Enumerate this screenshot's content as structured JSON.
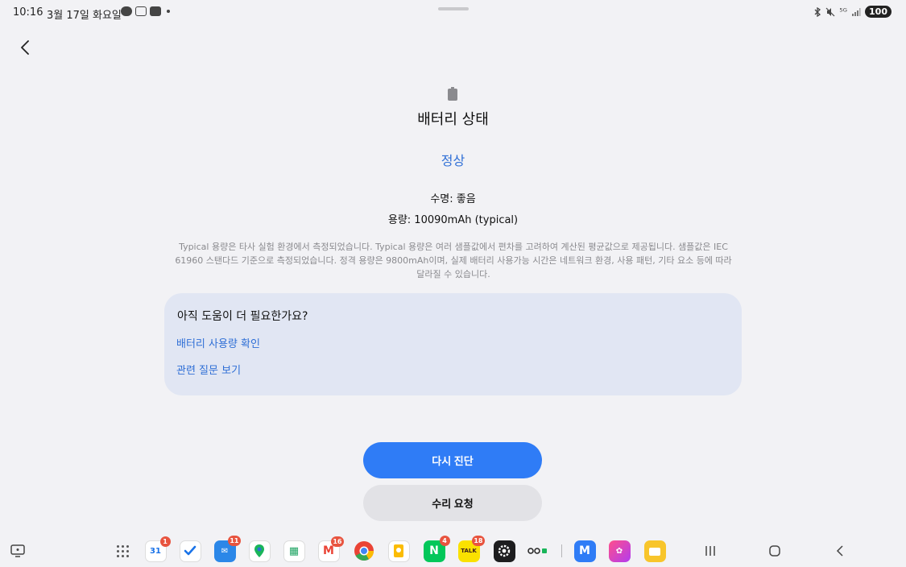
{
  "status_bar": {
    "time": "10:16",
    "date": "3월 17일 화요일",
    "battery_level": "100",
    "icons_left": [
      "talk-icon",
      "screenshot-icon",
      "youtube-icon",
      "dot-icon"
    ],
    "icons_right": [
      "bluetooth-icon",
      "mute-icon",
      "5g-icon",
      "signal-icon"
    ]
  },
  "header": {
    "back_icon": "back-arrow-icon"
  },
  "battery": {
    "title": "배터리 상태",
    "status": "정상",
    "lifespan": "수명: 좋음",
    "capacity": "용량: 10090mAh (typical)",
    "note": "Typical 용량은 타사 실험 환경에서 측정되었습니다. Typical 용량은 여러 샘플값에서 편차를 고려하여 계산된 평균값으로 제공됩니다. 샘플값은 IEC 61960 스탠다드 기준으로 측정되었습니다. 정격 용량은 9800mAh이며, 실제 배터리 사용가능 시간은 네트워크 환경, 사용 패턴, 기타 요소 등에 따라 달라질 수 있습니다."
  },
  "help": {
    "title": "아직 도움이 더 필요한가요?",
    "link_usage": "배터리 사용량 확인",
    "link_faq": "관련 질문 보기"
  },
  "buttons": {
    "rediagnose": "다시 진단",
    "repair_request": "수리 요청"
  },
  "taskbar": {
    "badges": {
      "calendar": "1",
      "mail_app": "11",
      "gmail": "16",
      "naver": "4",
      "kakaotalk": "18"
    },
    "app_labels": {
      "calendar": "31",
      "sheets": "▦",
      "gmail": "M",
      "naver": "N",
      "kakaotalk": "TALK",
      "mybox": "M"
    },
    "colors": {
      "accent_blue": "#2f7cf6",
      "link_blue": "#2f6fd6",
      "card_bg": "#e1e6f3"
    }
  }
}
